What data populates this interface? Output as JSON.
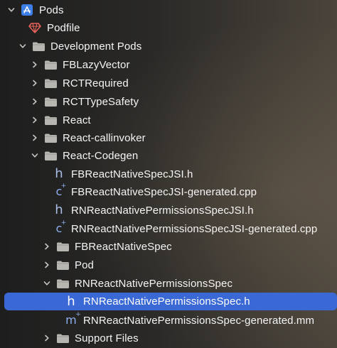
{
  "colors": {
    "selection": "#3a69d6",
    "folder": "#b8b6b1",
    "project_icon": "#3d7fe8",
    "swift_ruby_icon": "#e8635a",
    "source_icon": "#8fb0f0"
  },
  "tree": [
    {
      "label": "Pods",
      "icon": "xcodeproj-icon",
      "disclosure": "expanded"
    },
    {
      "label": "Podfile",
      "icon": "ruby-gem-icon",
      "disclosure": "none"
    },
    {
      "label": "Development Pods",
      "icon": "folder-icon",
      "disclosure": "expanded"
    },
    {
      "label": "FBLazyVector",
      "icon": "folder-icon",
      "disclosure": "collapsed"
    },
    {
      "label": "RCTRequired",
      "icon": "folder-icon",
      "disclosure": "collapsed"
    },
    {
      "label": "RCTTypeSafety",
      "icon": "folder-icon",
      "disclosure": "collapsed"
    },
    {
      "label": "React",
      "icon": "folder-icon",
      "disclosure": "collapsed"
    },
    {
      "label": "React-callinvoker",
      "icon": "folder-icon",
      "disclosure": "collapsed"
    },
    {
      "label": "React-Codegen",
      "icon": "folder-icon",
      "disclosure": "expanded"
    },
    {
      "label": "FBReactNativeSpecJSI.h",
      "icon": "header-file-icon",
      "disclosure": "none"
    },
    {
      "label": "FBReactNativeSpecJSI-generated.cpp",
      "icon": "cpp-file-icon",
      "disclosure": "none"
    },
    {
      "label": "RNReactNativePermissionsSpecJSI.h",
      "icon": "header-file-icon",
      "disclosure": "none"
    },
    {
      "label": "RNReactNativePermissionsSpecJSI-generated.cpp",
      "icon": "cpp-file-icon",
      "disclosure": "none"
    },
    {
      "label": "FBReactNativeSpec",
      "icon": "folder-icon",
      "disclosure": "collapsed"
    },
    {
      "label": "Pod",
      "icon": "folder-icon",
      "disclosure": "collapsed"
    },
    {
      "label": "RNReactNativePermissionsSpec",
      "icon": "folder-icon",
      "disclosure": "expanded"
    },
    {
      "label": "RNReactNativePermissionsSpec.h",
      "icon": "header-file-icon",
      "disclosure": "none",
      "selected": true
    },
    {
      "label": "RNReactNativePermissionsSpec-generated.mm",
      "icon": "objcpp-file-icon",
      "disclosure": "none"
    },
    {
      "label": "Support Files",
      "icon": "folder-icon",
      "disclosure": "collapsed"
    }
  ],
  "glyphs": {
    "header": "h",
    "cpp": "c",
    "objcpp": "m",
    "plus": "+"
  }
}
